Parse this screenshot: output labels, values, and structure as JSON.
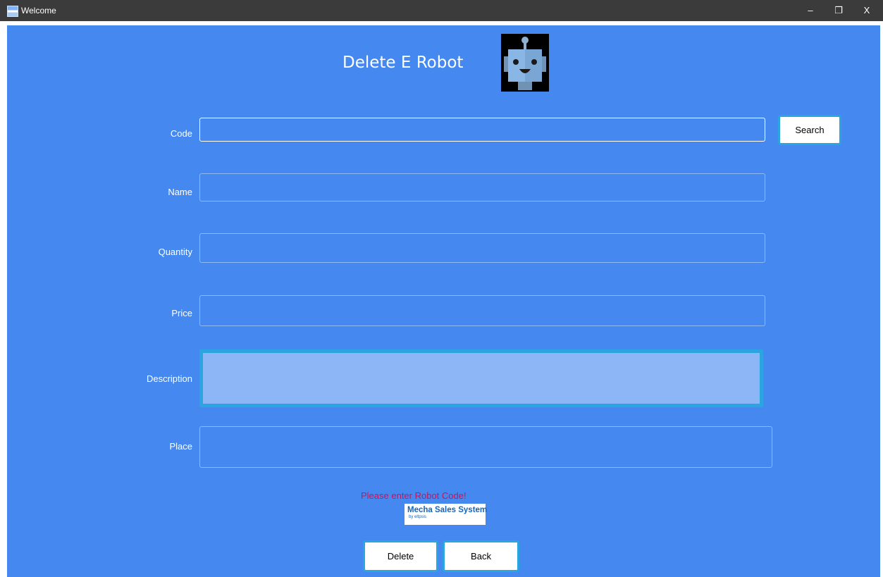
{
  "window": {
    "title": "Welcome",
    "controls": {
      "minimize": "–",
      "restore": "❐",
      "close": "X"
    }
  },
  "header": {
    "title": "Delete E Robot",
    "logo": {
      "icon": "robot-face-icon"
    }
  },
  "form": {
    "code": {
      "label": "Code",
      "value": ""
    },
    "name": {
      "label": "Name",
      "value": ""
    },
    "quantity": {
      "label": "Quantity",
      "value": ""
    },
    "price": {
      "label": "Price",
      "value": ""
    },
    "description": {
      "label": "Description",
      "value": ""
    },
    "place": {
      "label": "Place",
      "value": ""
    }
  },
  "buttons": {
    "search": "Search",
    "delete": "Delete",
    "back": "Back"
  },
  "status": {
    "message": "Please enter Robot Code!"
  },
  "branding": {
    "name": "Mecha Sales System",
    "byline": "by eltpsis"
  },
  "colors": {
    "background": "#4488f0",
    "titlebar": "#3b3b3b",
    "accent_border": "#2aa5df",
    "description_fill": "#8db6f7",
    "status_text": "#c2185b"
  }
}
